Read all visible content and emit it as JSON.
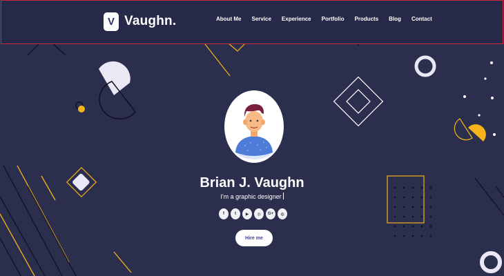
{
  "brand": {
    "initial": "V",
    "name": "Vaughn",
    "dot": "."
  },
  "nav": {
    "items": [
      {
        "label": "About Me"
      },
      {
        "label": "Service"
      },
      {
        "label": "Experience"
      },
      {
        "label": "Portfolio"
      },
      {
        "label": "Products"
      },
      {
        "label": "Blog"
      },
      {
        "label": "Contact"
      }
    ]
  },
  "hero": {
    "name": "Brian J. Vaughn",
    "role": "I'm a graphic designer",
    "hire_label": "Hire me"
  },
  "socials": [
    {
      "icon": "facebook-icon",
      "glyph": "f"
    },
    {
      "icon": "twitter-icon",
      "glyph": "t"
    },
    {
      "icon": "youtube-icon",
      "glyph": "▶"
    },
    {
      "icon": "instagram-icon",
      "glyph": "◎"
    },
    {
      "icon": "google-plus-icon",
      "glyph": "G+"
    },
    {
      "icon": "dribbble-icon",
      "glyph": "◍"
    }
  ],
  "colors": {
    "background": "#2b2e4d",
    "accent_yellow": "#f5b41a",
    "brand_purple": "#3b3fa6",
    "nav_border": "#c8283a"
  }
}
